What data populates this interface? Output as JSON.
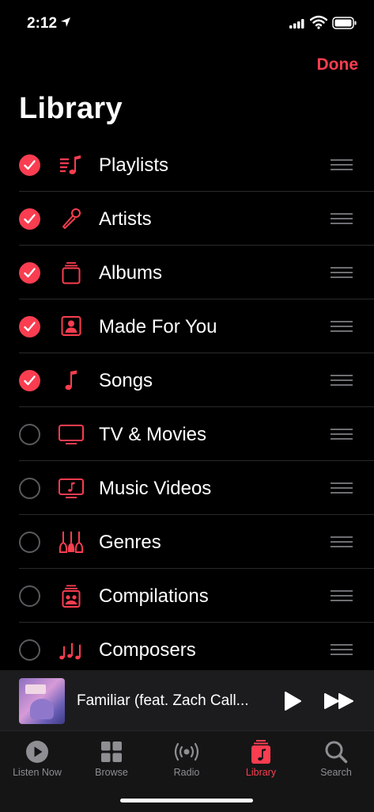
{
  "status_bar": {
    "time": "2:12"
  },
  "header": {
    "done_label": "Done",
    "title": "Library"
  },
  "library_items": [
    {
      "label": "Playlists",
      "icon": "playlists-icon",
      "checked": true
    },
    {
      "label": "Artists",
      "icon": "microphone-icon",
      "checked": true
    },
    {
      "label": "Albums",
      "icon": "album-stack-icon",
      "checked": true
    },
    {
      "label": "Made For You",
      "icon": "person-square-icon",
      "checked": true
    },
    {
      "label": "Songs",
      "icon": "music-note-icon",
      "checked": true
    },
    {
      "label": "TV & Movies",
      "icon": "tv-icon",
      "checked": false
    },
    {
      "label": "Music Videos",
      "icon": "music-video-icon",
      "checked": false
    },
    {
      "label": "Genres",
      "icon": "guitars-icon",
      "checked": false
    },
    {
      "label": "Compilations",
      "icon": "compilation-icon",
      "checked": false
    },
    {
      "label": "Composers",
      "icon": "composer-notes-icon",
      "checked": false
    }
  ],
  "now_playing": {
    "title": "Familiar (feat. Zach Call..."
  },
  "tabs": [
    {
      "label": "Listen Now",
      "icon": "play-circle-icon",
      "active": false
    },
    {
      "label": "Browse",
      "icon": "grid-icon",
      "active": false
    },
    {
      "label": "Radio",
      "icon": "radio-waves-icon",
      "active": false
    },
    {
      "label": "Library",
      "icon": "library-icon",
      "active": true
    },
    {
      "label": "Search",
      "icon": "magnifier-icon",
      "active": false
    }
  ],
  "colors": {
    "accent": "#fa3d50",
    "background": "#000000",
    "inactive": "#8e8e93"
  }
}
